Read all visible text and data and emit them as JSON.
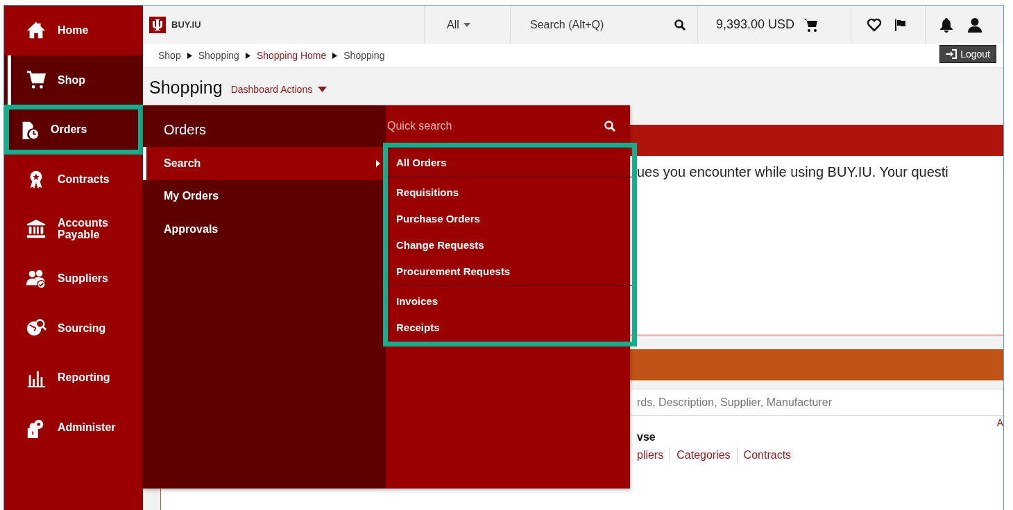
{
  "sidebar": {
    "items": [
      {
        "label": "Home",
        "selected": false,
        "open": false,
        "highlighted": false
      },
      {
        "label": "Shop",
        "selected": true,
        "open": false,
        "highlighted": false
      },
      {
        "label": "Orders",
        "selected": false,
        "open": true,
        "highlighted": true
      },
      {
        "label": "Contracts",
        "selected": false,
        "open": false,
        "highlighted": false
      },
      {
        "label": "Accounts Payable",
        "selected": false,
        "open": false,
        "highlighted": false
      },
      {
        "label": "Suppliers",
        "selected": false,
        "open": false,
        "highlighted": false
      },
      {
        "label": "Sourcing",
        "selected": false,
        "open": false,
        "highlighted": false
      },
      {
        "label": "Reporting",
        "selected": false,
        "open": false,
        "highlighted": false
      },
      {
        "label": "Administer",
        "selected": false,
        "open": false,
        "highlighted": false
      }
    ]
  },
  "topbar": {
    "logo_text": "BUY.IU",
    "scope": "All",
    "search_placeholder": "Search (Alt+Q)",
    "cart_total": "9,393.00 USD"
  },
  "breadcrumb": [
    {
      "label": "Shop",
      "link": false
    },
    {
      "label": "Shopping",
      "link": false
    },
    {
      "label": "Shopping Home",
      "link": true
    },
    {
      "label": "Shopping",
      "link": false
    }
  ],
  "logout": "Logout",
  "page": {
    "title": "Shopping",
    "actions": "Dashboard Actions"
  },
  "flyout": {
    "title": "Orders",
    "items": [
      {
        "label": "Search",
        "selected": true
      },
      {
        "label": "My Orders",
        "selected": false
      },
      {
        "label": "Approvals",
        "selected": false
      }
    ],
    "quick_search_placeholder": "Quick search",
    "highlighted": true,
    "groups": [
      [
        "All Orders"
      ],
      [
        "Requisitions",
        "Purchase Orders",
        "Change Requests",
        "Procurement Requests"
      ],
      [
        "Invoices",
        "Receipts"
      ]
    ]
  },
  "background": {
    "notice": "ues you encounter while using BUY.IU. Your questi",
    "search_placeholder": "rds, Description, Supplier, Manufacturer",
    "corner_link": "A",
    "browse_heading": "vse",
    "browse_links": [
      "pliers",
      "Categories",
      "Contracts"
    ]
  }
}
